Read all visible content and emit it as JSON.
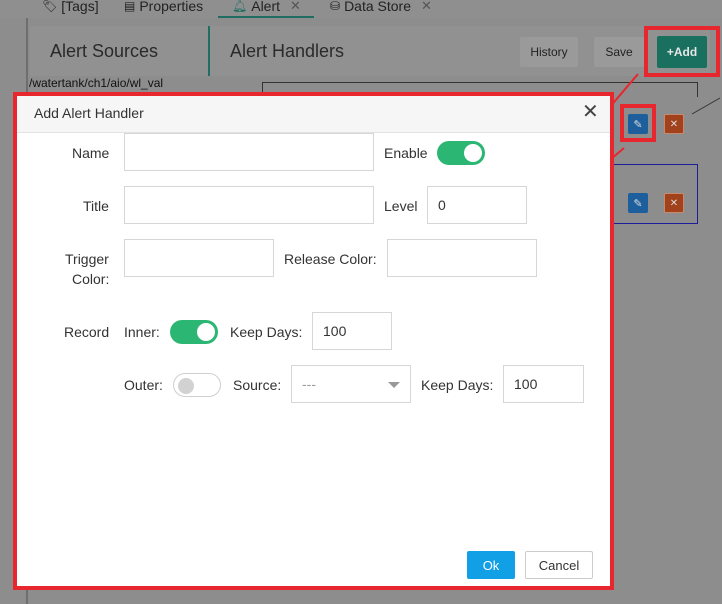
{
  "tabs": [
    {
      "icon": "tags-icon",
      "label": "[Tags]",
      "closable": false
    },
    {
      "icon": "properties-icon",
      "label": "Properties",
      "closable": false
    },
    {
      "icon": "bell-icon",
      "label": "Alert",
      "closable": true,
      "active": true
    },
    {
      "icon": "database-icon",
      "label": "Data Store",
      "closable": true
    }
  ],
  "panels": {
    "alert_sources_title": "Alert Sources",
    "alert_handlers_title": "Alert Handlers",
    "source_path": "/watertank/ch1/aio/wl_val"
  },
  "toolbar": {
    "history_label": "History",
    "save_label": "Save",
    "add_label": "+Add"
  },
  "dialog": {
    "title": "Add Alert Handler",
    "name_label": "Name",
    "name_value": "",
    "enable_label": "Enable",
    "enable_on": true,
    "title_label": "Title",
    "title_value": "",
    "level_label": "Level",
    "level_value": "0",
    "trigger_color_label_1": "Trigger",
    "trigger_color_label_2": "Color:",
    "trigger_color_value": "",
    "release_color_label": "Release Color:",
    "release_color_value": "",
    "record_label": "Record",
    "inner_label": "Inner:",
    "inner_on": true,
    "inner_keep_days_label": "Keep Days:",
    "inner_keep_days_value": "100",
    "outer_label": "Outer:",
    "outer_on": false,
    "source_label": "Source:",
    "source_value": "---",
    "outer_keep_days_label": "Keep Days:",
    "outer_keep_days_value": "100",
    "ok_label": "Ok",
    "cancel_label": "Cancel"
  },
  "colors": {
    "highlight_red": "#e8262e",
    "toggle_green": "#2bb673",
    "ok_blue": "#119fe6",
    "add_green": "#19705f"
  }
}
